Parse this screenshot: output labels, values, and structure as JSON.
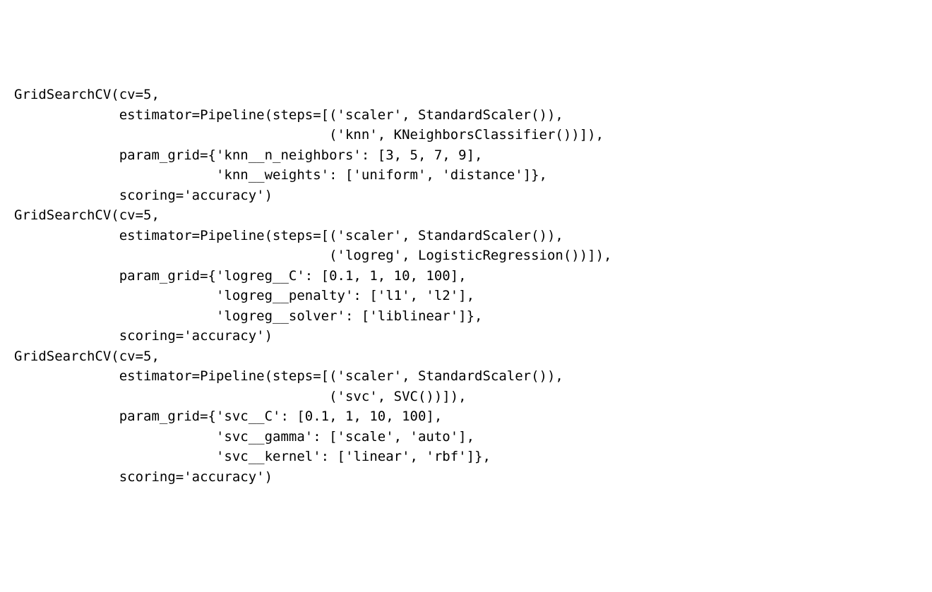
{
  "code": {
    "lines": [
      "GridSearchCV(cv=5,",
      "             estimator=Pipeline(steps=[('scaler', StandardScaler()),",
      "                                       ('knn', KNeighborsClassifier())]),",
      "             param_grid={'knn__n_neighbors': [3, 5, 7, 9],",
      "                         'knn__weights': ['uniform', 'distance']},",
      "             scoring='accuracy')",
      "GridSearchCV(cv=5,",
      "             estimator=Pipeline(steps=[('scaler', StandardScaler()),",
      "                                       ('logreg', LogisticRegression())]),",
      "             param_grid={'logreg__C': [0.1, 1, 10, 100],",
      "                         'logreg__penalty': ['l1', 'l2'],",
      "                         'logreg__solver': ['liblinear']},",
      "             scoring='accuracy')",
      "GridSearchCV(cv=5,",
      "             estimator=Pipeline(steps=[('scaler', StandardScaler()),",
      "                                       ('svc', SVC())]),",
      "             param_grid={'svc__C': [0.1, 1, 10, 100],",
      "                         'svc__gamma': ['scale', 'auto'],",
      "                         'svc__kernel': ['linear', 'rbf']},",
      "             scoring='accuracy')"
    ]
  }
}
